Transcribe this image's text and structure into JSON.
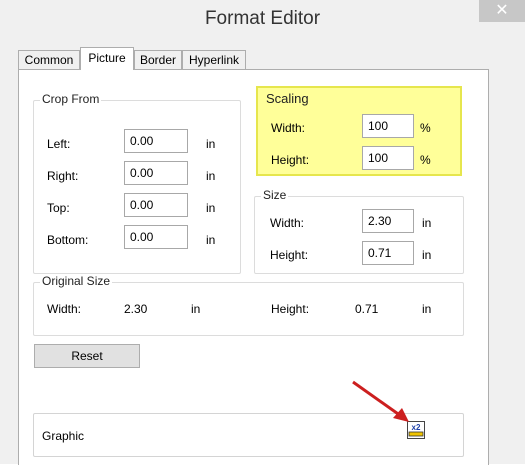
{
  "window": {
    "title": "Format Editor",
    "close_glyph": "✕"
  },
  "tabs": [
    {
      "label": "Common",
      "active": false
    },
    {
      "label": "Picture",
      "active": true
    },
    {
      "label": "Border",
      "active": false
    },
    {
      "label": "Hyperlink",
      "active": false
    }
  ],
  "crop_from": {
    "title": "Crop From",
    "rows": [
      {
        "label": "Left:",
        "value": "0.00",
        "unit": "in"
      },
      {
        "label": "Right:",
        "value": "0.00",
        "unit": "in"
      },
      {
        "label": "Top:",
        "value": "0.00",
        "unit": "in"
      },
      {
        "label": "Bottom:",
        "value": "0.00",
        "unit": "in"
      }
    ]
  },
  "scaling": {
    "title": "Scaling",
    "highlight_color": "#ffff99",
    "width_label": "Width:",
    "width_value": "100",
    "width_unit": "%",
    "height_label": "Height:",
    "height_value": "100",
    "height_unit": "%"
  },
  "size": {
    "title": "Size",
    "width_label": "Width:",
    "width_value": "2.30",
    "width_unit": "in",
    "height_label": "Height:",
    "height_value": "0.71",
    "height_unit": "in"
  },
  "original_size": {
    "title": "Original Size",
    "width_label": "Width:",
    "width_value": "2.30",
    "width_unit": "in",
    "height_label": "Height:",
    "height_value": "0.71",
    "height_unit": "in"
  },
  "reset_label": "Reset",
  "graphic": {
    "label": "Graphic",
    "icon": "x2-scale-icon",
    "icon_text": "x2"
  },
  "annotation": {
    "arrow_color": "#cc1f1f"
  }
}
